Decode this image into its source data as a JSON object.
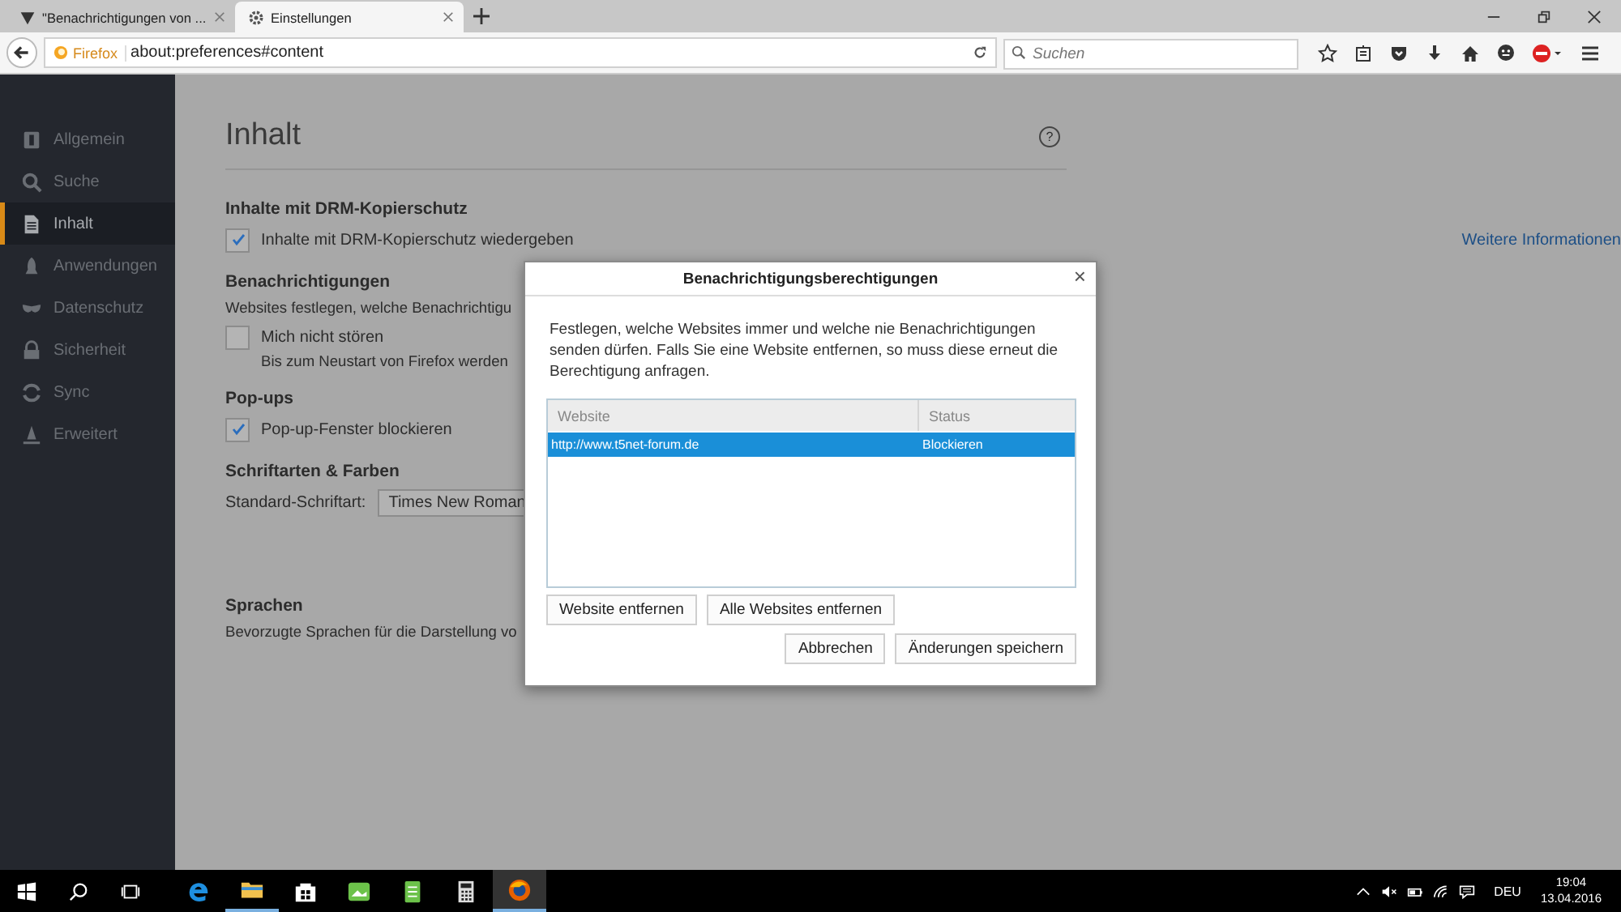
{
  "tabs": [
    {
      "title": "\"Benachrichtigungen von ...",
      "kind": "forum",
      "selected": false
    },
    {
      "title": "Einstellungen",
      "kind": "settings",
      "selected": true
    }
  ],
  "nav": {
    "brand": "Firefox",
    "url": "about:preferences#content",
    "search_placeholder": "Suchen"
  },
  "sidebar": {
    "items": [
      {
        "label": "Allgemein",
        "kind": "general",
        "selected": false
      },
      {
        "label": "Suche",
        "kind": "search",
        "selected": false
      },
      {
        "label": "Inhalt",
        "kind": "content",
        "selected": true
      },
      {
        "label": "Anwendungen",
        "kind": "apps",
        "selected": false
      },
      {
        "label": "Datenschutz",
        "kind": "privacy",
        "selected": false
      },
      {
        "label": "Sicherheit",
        "kind": "security",
        "selected": false
      },
      {
        "label": "Sync",
        "kind": "sync",
        "selected": false
      },
      {
        "label": "Erweitert",
        "kind": "advanced",
        "selected": false
      }
    ]
  },
  "page": {
    "title": "Inhalt",
    "help": "?",
    "drm": {
      "heading": "Inhalte mit DRM-Kopierschutz",
      "checkbox": {
        "label": "Inhalte mit DRM-Kopierschutz wiedergeben",
        "checked": true
      },
      "link": "Weitere Informationen"
    },
    "notifications": {
      "heading": "Benachrichtigungen",
      "description": "Websites festlegen, welche Benachrichtigu",
      "checkbox": {
        "label": "Mich nicht stören",
        "checked": false
      },
      "note": "Bis zum Neustart von Firefox werden"
    },
    "popups": {
      "heading": "Pop-ups",
      "checkbox": {
        "label": "Pop-up-Fenster blockieren",
        "checked": true
      }
    },
    "fonts": {
      "heading": "Schriftarten & Farben",
      "label": "Standard-Schriftart:",
      "value": "Times New Roman"
    },
    "languages": {
      "heading": "Sprachen",
      "description": "Bevorzugte Sprachen für die Darstellung vo"
    }
  },
  "dialog": {
    "title": "Benachrichtigungsberechtigungen",
    "close": "×",
    "description": "Festlegen, welche Websites immer und welche nie Benachrichtigungen senden dürfen. Falls Sie eine Website entfernen, so muss diese erneut die Berechtigung anfragen.",
    "columns": [
      "Website",
      "Status"
    ],
    "rows": [
      {
        "website": "http://www.t5net-forum.de",
        "status": "Blockieren",
        "selected": true
      }
    ],
    "buttons": {
      "remove": "Website entfernen",
      "remove_all": "Alle Websites entfernen",
      "cancel": "Abbrechen",
      "save": "Änderungen speichern"
    }
  },
  "taskbar": {
    "apps": [
      {
        "kind": "edge",
        "running": false,
        "active": false
      },
      {
        "kind": "explorer",
        "running": true,
        "active": false
      },
      {
        "kind": "store",
        "running": false,
        "active": false
      },
      {
        "kind": "photos",
        "running": false,
        "active": false
      },
      {
        "kind": "notes",
        "running": false,
        "active": false
      },
      {
        "kind": "calculator",
        "running": false,
        "active": false
      },
      {
        "kind": "firefox",
        "running": true,
        "active": true
      }
    ],
    "language": "DEU",
    "time": "19:04",
    "date": "13.04.2016"
  }
}
